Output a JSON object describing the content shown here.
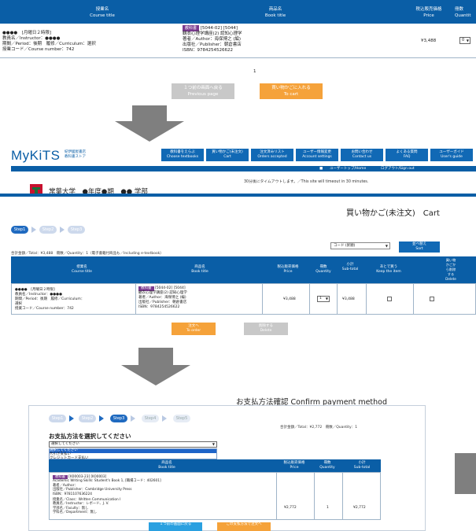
{
  "panel1": {
    "headers": {
      "course_jp": "授業名",
      "course_en": "Course title",
      "book_jp": "商品名",
      "book_en": "Book title",
      "price_jp": "税込販売価格",
      "price_en": "Price",
      "qty_jp": "冊数",
      "qty_en": "Quantit"
    },
    "row": {
      "course_lines": [
        "●●●●　[月曜日２時限]",
        "教員名／Instructor：●●●●",
        "期間／Period：後期　履修／Curriculum：選択",
        "授業コード／Course number：742"
      ],
      "tag": "教科書",
      "code": "[5044-02] [5044]",
      "book_lines": [
        "観衣心理学講座(2) 認知心理学",
        "著者／Author：海保博之 (編)",
        "出版社／Publisher：朝倉書店",
        "ISBN：9784254526622"
      ],
      "price": "¥3,488",
      "qty": "0"
    },
    "page_number": "1",
    "prev_button": [
      "１つ前の画面へ戻る",
      "Previous page"
    ],
    "cart_button": [
      "買い物かごに入れる",
      "To cart"
    ]
  },
  "panel2": {
    "logo": "MyKiTS",
    "logo_sub": [
      "紀伊國屋書店",
      "教科書ストア"
    ],
    "nav": [
      [
        "教科書をえらぶ",
        "Choose textbooks"
      ],
      [
        "買い物かご(未注文)",
        "Cart"
      ],
      [
        "注文済みリスト",
        "Orders accepted"
      ],
      [
        "ユーザー情報変更",
        "Account settings"
      ],
      [
        "お問い合わせ",
        "Contact us"
      ],
      [
        "よくある質問",
        "FAQ"
      ],
      [
        "ユーザーガイド",
        "User's guide"
      ]
    ],
    "topbar": [
      "ユーザートップ/Home",
      "ログアウト/Sign out"
    ],
    "timeout": "30分後にタイムアウトします。／This site will timeout in 30 minutes.",
    "university": "常葉大学　●年度●期　●● 学部",
    "page_title": "買い物かご(未注文)　Cart",
    "steps": [
      "Step1",
      "Step2",
      "Step3"
    ],
    "total": "合計金額／Total：¥3,488　冊数／Quantity：1（電子書籍付商品も／Including e-textbook）",
    "sort_select": "コード (昇順)",
    "sort_button": [
      "並べ替え",
      "Sort"
    ],
    "headers": {
      "course_jp": "授業名",
      "course_en": "Course title",
      "book_jp": "商品名",
      "book_en": "Book title",
      "price_jp": "税込販売価格",
      "price_en": "Price",
      "qty_jp": "冊数",
      "qty_en": "Quantity",
      "sub_jp": "小計",
      "sub_en": "Sub-total",
      "keep_jp": "あとで買う",
      "keep_en": "Keep the item",
      "del_lines": [
        "買い物",
        "かごか",
        "ら削除",
        "する",
        "Delete"
      ]
    },
    "row": {
      "course_lines": [
        "●●●●　[月曜日２時限]",
        "教員名／Instructor：●●●●",
        "期間／Period：後期　履修／Curriculum：",
        "選択",
        "授業コード／Course number：742"
      ],
      "tag": "教科書",
      "code": "[5044-02] [5044]",
      "book_lines": [
        "観衣心理学講座(2) 認知心理学",
        "著者／Author：海保博之 (編)",
        "出版社／Publisher：朝倉書店",
        "ISBN：9784254526622"
      ],
      "price": "¥3,488",
      "qty": "1",
      "subtotal": "¥3,488"
    },
    "order_button": [
      "注文へ",
      "To order"
    ],
    "delete_button": [
      "削除する",
      "Delete"
    ]
  },
  "panel3": {
    "title": "お支払方法確認 Confirm payment method",
    "steps": [
      "Step1",
      "Step2",
      "Step3",
      "Step4",
      "Step5"
    ],
    "total": "合計金額／Total：¥2,772　冊数／Quantity：1",
    "select_label": "お支払方法を選択してください",
    "select_value": "選択してください",
    "options": [
      "選択してください",
      "代引き支払い",
      "クレジットカード支払い"
    ],
    "headers": {
      "book_jp": "商品名",
      "book_en": "Book title",
      "price_jp": "税込販売価格",
      "price_en": "Price",
      "qty_jp": "冊数",
      "qty_en": "Quantity",
      "sub_jp": "小計",
      "sub_en": "Sub-total"
    },
    "row": {
      "tag": "教科書",
      "code": "[K00003-23] [K00003]",
      "book_lines": [
        "Academic Writing Skills: Student's Book 1, [職場コード：402601]",
        "著者／Author：",
        "出版社／Publisher：Cambridge University Press",
        "ISBN：9781107636224"
      ],
      "class_lines": [
        "授業名／Class：Written Communication I",
        "教員名／Instructor：レボード、J. V.",
        "学部名／Faculty：無し",
        "学科名／Department：無し"
      ],
      "price": "¥2,772",
      "qty": "1",
      "subtotal": "¥2,772"
    },
    "prev_button": [
      "１つ前の画面に戻る",
      "Previous page"
    ],
    "confirm_button": [
      "この支払方法で注文へ",
      "Confirm order"
    ]
  }
}
